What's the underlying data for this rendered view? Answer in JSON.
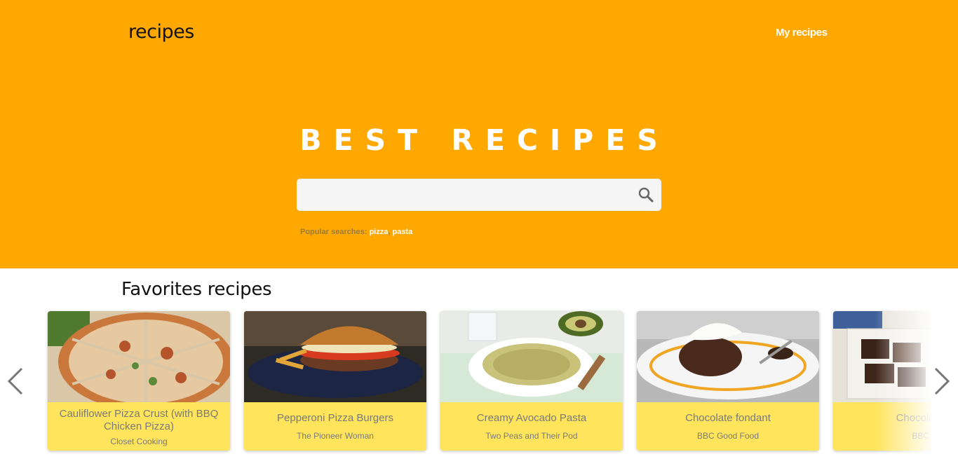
{
  "header": {
    "logo": "recipes",
    "nav_link": "My recipes"
  },
  "hero": {
    "title": "BEST RECIPES",
    "search": {
      "value": "",
      "placeholder": ""
    },
    "popular_label": "Popular searches:",
    "popular": [
      "pizza",
      "pasta"
    ]
  },
  "favorites": {
    "title": "Favorites recipes",
    "cards": [
      {
        "title": "Cauliflower Pizza Crust (with BBQ Chicken Pizza)",
        "source": "Closet Cooking"
      },
      {
        "title": "Pepperoni Pizza Burgers",
        "source": "The Pioneer Woman"
      },
      {
        "title": "Creamy Avocado Pasta",
        "source": "Two Peas and Their Pod"
      },
      {
        "title": "Chocolate fondant",
        "source": "BBC Good Food"
      },
      {
        "title": "Chocolate fr",
        "source": "BBC F"
      }
    ]
  },
  "icons": {
    "search": "search-icon",
    "prev": "chevron-left-icon",
    "next": "chevron-right-icon"
  },
  "colors": {
    "hero": "#ffa801",
    "card_body": "#ffe45c",
    "text_muted": "#7a7a7a"
  }
}
